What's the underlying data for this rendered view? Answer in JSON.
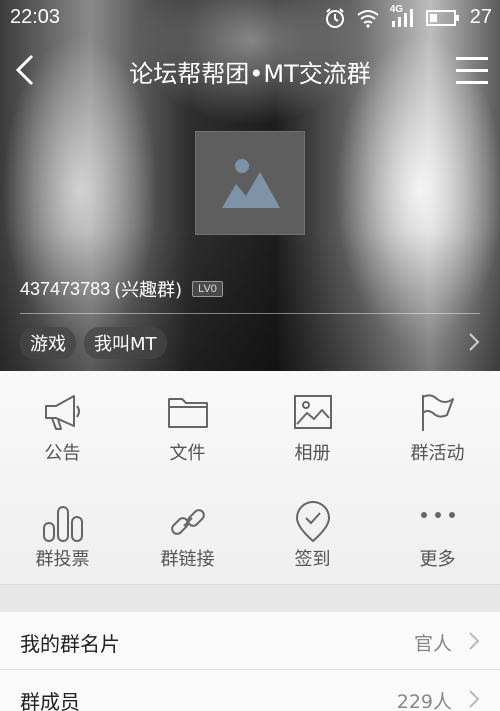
{
  "status_bar": {
    "time": "22:03",
    "network": "4G",
    "battery": "27",
    "icons": [
      "alarm-icon",
      "wifi-icon",
      "signal-icon",
      "battery-icon"
    ]
  },
  "header": {
    "title": "论坛帮帮团•MT交流群",
    "back_icon": "chevron-left-icon",
    "menu_icon": "hamburger-menu-icon"
  },
  "group": {
    "avatar_icon": "image-placeholder-icon",
    "id": "437473783",
    "type": "(兴趣群)",
    "level": "LV0",
    "tags": [
      "游戏",
      "我叫MT"
    ]
  },
  "actions": [
    {
      "label": "公告",
      "icon": "megaphone-icon"
    },
    {
      "label": "文件",
      "icon": "folder-icon"
    },
    {
      "label": "相册",
      "icon": "photo-album-icon"
    },
    {
      "label": "群活动",
      "icon": "flag-icon"
    },
    {
      "label": "群投票",
      "icon": "bar-chart-icon"
    },
    {
      "label": "群链接",
      "icon": "link-icon"
    },
    {
      "label": "签到",
      "icon": "checkin-pin-icon"
    },
    {
      "label": "更多",
      "icon": "more-dots-icon"
    }
  ],
  "list": [
    {
      "label": "我的群名片",
      "value": "官人"
    },
    {
      "label": "群成员",
      "value": "229人"
    }
  ],
  "colors": {
    "icon_gray": "#666666",
    "label_gray": "#555555",
    "value_gray": "#888888"
  }
}
